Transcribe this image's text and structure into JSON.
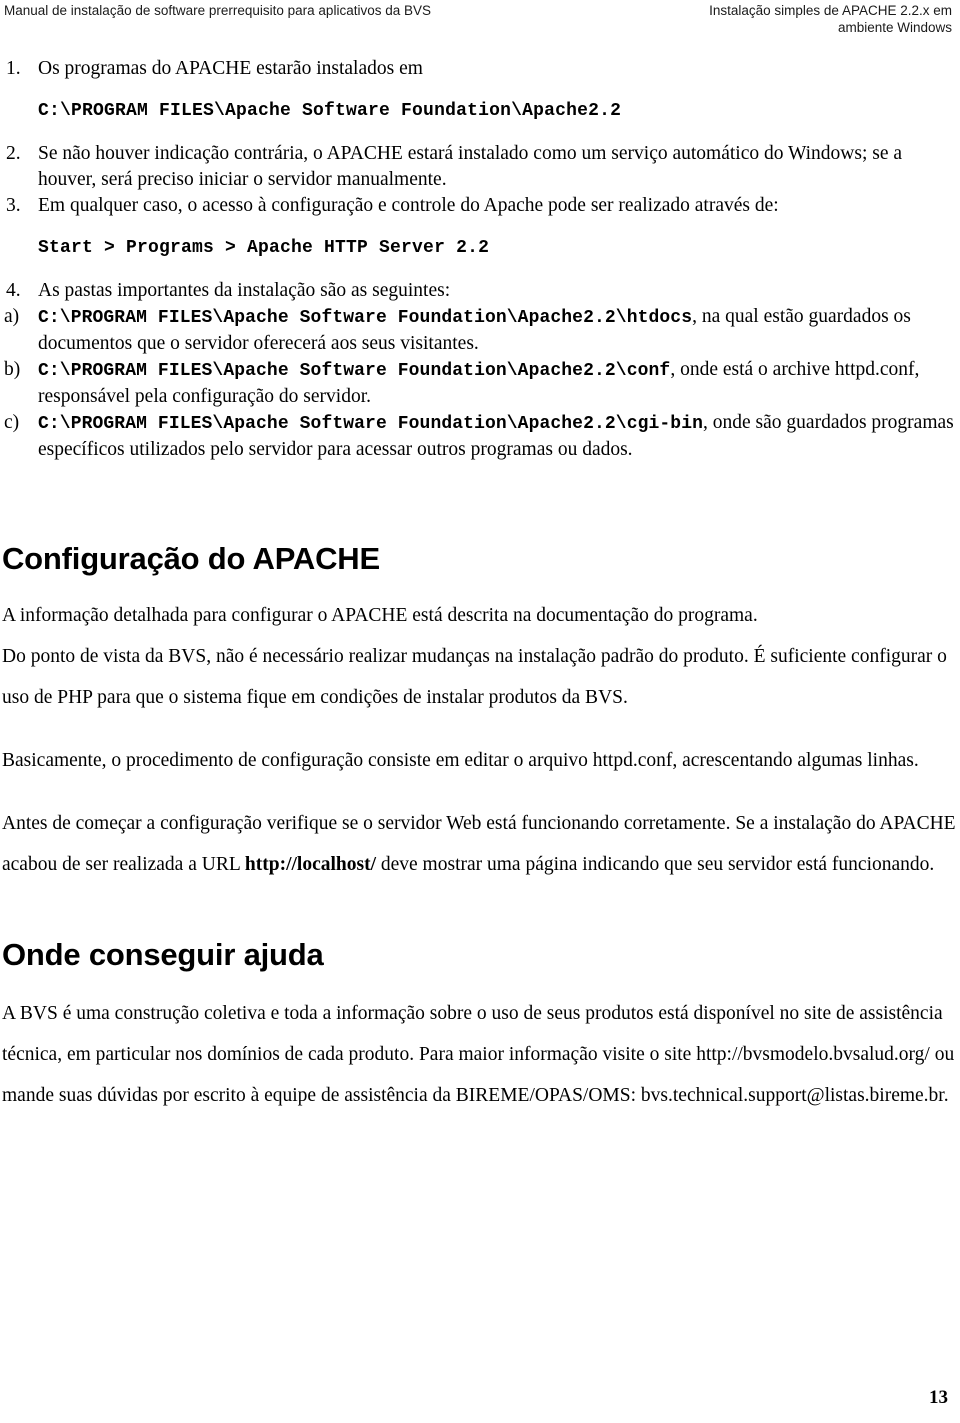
{
  "header": {
    "left": "Manual de instalação de software prerrequisito para aplicativos da BVS",
    "right_line1": "Instalação simples de APACHE 2.2.x em",
    "right_line2": "ambiente Windows"
  },
  "list": {
    "items": [
      {
        "marker": "1.",
        "text": "Os programas do APACHE estarão instalados em"
      },
      {
        "marker": "2.",
        "text": "Se não houver indicação contrária, o APACHE estará instalado como um serviço automático do Windows; se a houver, será preciso iniciar o servidor manualmente."
      },
      {
        "marker": "3.",
        "text": "Em qualquer caso, o acesso à configuração e controle do Apache pode ser realizado através de:"
      },
      {
        "marker": "4.",
        "text": "As pastas importantes da instalação são as seguintes:"
      }
    ],
    "code1": "C:\\PROGRAM FILES\\Apache Software Foundation\\Apache2.2",
    "code2": "Start > Programs > Apache HTTP Server 2.2",
    "sub_items": [
      {
        "marker": "a)",
        "code": "C:\\PROGRAM FILES\\Apache Software Foundation\\Apache2.2\\htdocs",
        "text": ", na qual estão guardados os documentos que o servidor oferecerá aos seus visitantes."
      },
      {
        "marker": "b)",
        "code": "C:\\PROGRAM FILES\\Apache Software Foundation\\Apache2.2\\conf",
        "text": ", onde está o archive httpd.conf, responsável pela configuração do servidor."
      },
      {
        "marker": "c)",
        "code": "C:\\PROGRAM FILES\\Apache Software Foundation\\Apache2.2\\cgi-bin",
        "text": ", onde são guardados programas específicos utilizados pelo servidor para acessar outros programas ou dados."
      }
    ]
  },
  "section_config": {
    "title": "Configuração do APACHE",
    "para1": "A informação detalhada para configurar o APACHE está descrita na documentação do programa.",
    "para2": "Do ponto de vista da BVS, não é necessário realizar mudanças na instalação padrão do produto. É suficiente configurar o uso de PHP para que o sistema fique em condições de instalar produtos da BVS.",
    "para3": "Basicamente, o procedimento de configuração consiste em editar o arquivo httpd.conf, acrescentando algumas linhas.",
    "para4_pre": "Antes de começar a configuração verifique se o servidor Web está funcionando corretamente. Se a instalação do APACHE acabou de ser realizada a URL ",
    "para4_url": "http://localhost/",
    "para4_post": " deve mostrar uma página indicando que seu servidor está funcionando."
  },
  "section_help": {
    "title": "Onde conseguir ajuda",
    "para1": "A BVS é uma construção coletiva e toda a informação sobre o uso de seus produtos está disponível no site de assistência técnica, em particular nos domínios de cada produto. Para maior informação visite o site http://bvsmodelo.bvsalud.org/ ou mande suas dúvidas por escrito à equipe de assistência da BIREME/OPAS/OMS: bvs.technical.support@listas.bireme.br."
  },
  "footer": {
    "page_number": "13"
  }
}
